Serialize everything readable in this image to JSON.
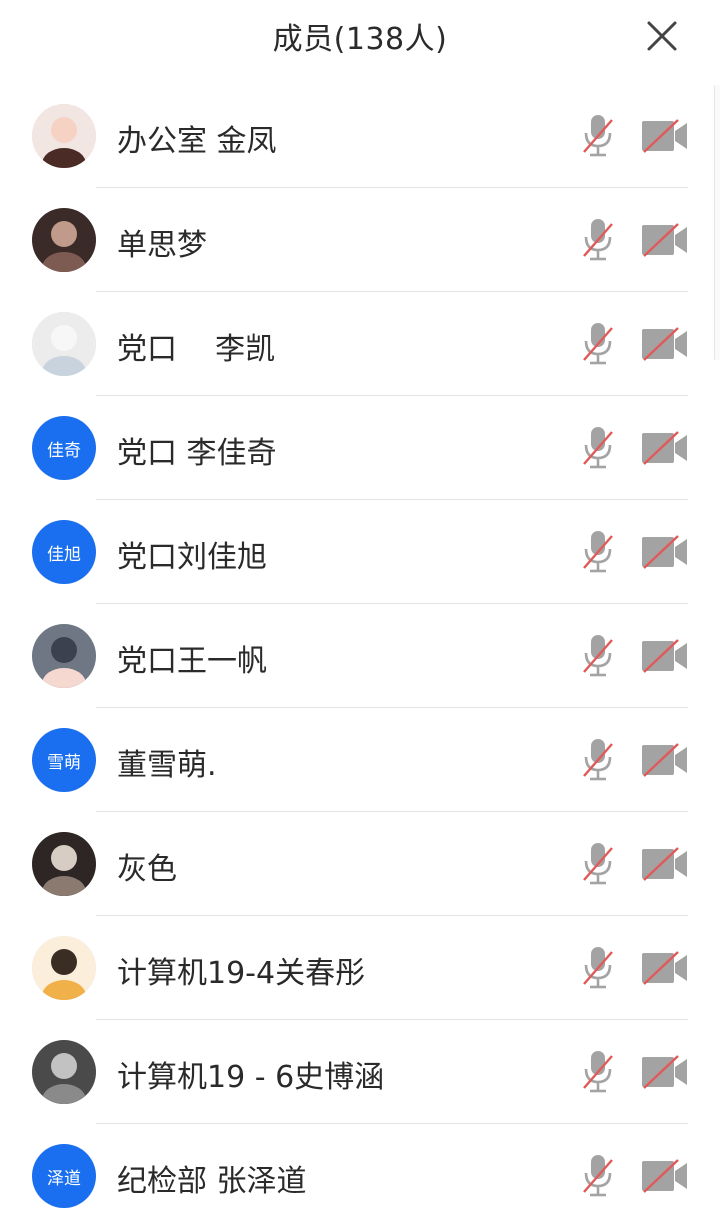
{
  "header": {
    "title": "成员(138人)",
    "close_icon": "close-icon"
  },
  "colors": {
    "accent": "#1a6ff0",
    "muted_icon": "#9a9a9a",
    "strike": "#e05a5a"
  },
  "members": [
    {
      "name": "办公室 金凤",
      "avatar_type": "photo",
      "avatar_text": "",
      "avatar_style": "cartoon-girl"
    },
    {
      "name": "单思梦",
      "avatar_type": "photo",
      "avatar_text": "",
      "avatar_style": "dark-photo"
    },
    {
      "name": "党口    李凯",
      "avatar_type": "photo",
      "avatar_text": "",
      "avatar_style": "sketch-figure"
    },
    {
      "name": "党口 李佳奇",
      "avatar_type": "text",
      "avatar_text": "佳奇",
      "avatar_style": ""
    },
    {
      "name": "党口刘佳旭",
      "avatar_type": "text",
      "avatar_text": "佳旭",
      "avatar_style": ""
    },
    {
      "name": "党口王一帆",
      "avatar_type": "photo",
      "avatar_text": "",
      "avatar_style": "cartoon-blob"
    },
    {
      "name": "董雪萌.",
      "avatar_type": "text",
      "avatar_text": "雪萌",
      "avatar_style": ""
    },
    {
      "name": "灰色",
      "avatar_type": "photo",
      "avatar_text": "",
      "avatar_style": "dark-photo-2"
    },
    {
      "name": "计算机19-4关春彤",
      "avatar_type": "photo",
      "avatar_text": "",
      "avatar_style": "tiger-girl"
    },
    {
      "name": "计算机19 - 6史博涵",
      "avatar_type": "photo",
      "avatar_text": "",
      "avatar_style": "gray-cat"
    },
    {
      "name": "纪检部 张泽道",
      "avatar_type": "text",
      "avatar_text": "泽道",
      "avatar_style": ""
    }
  ],
  "row_icons": {
    "mic": "mic-muted-icon",
    "camera": "camera-off-icon"
  }
}
